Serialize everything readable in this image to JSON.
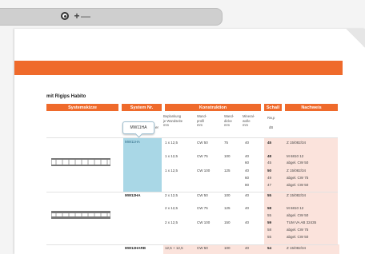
{
  "toolbar": {
    "zoom_in_label": "+",
    "zoom_out_label": "—",
    "target_icon": "target-icon"
  },
  "section": {
    "title": "mit Rigips Habito"
  },
  "table": {
    "headers": {
      "system_sketch": "Systemskizze",
      "system_no": "System Nr.",
      "construction": "Konstruktion",
      "sound": "Schall",
      "proof": "Nachweis"
    },
    "subheaders": {
      "planking": [
        "Beplankung",
        "je Wandseite",
        "mm"
      ],
      "wall_profile": [
        "Wand-",
        "profil",
        "mm"
      ],
      "wall_thickness": [
        "Wand-",
        "dicke",
        "mm"
      ],
      "mineral_wool": [
        "Mineral-",
        "wolle",
        "mm"
      ],
      "rw": "Rw,p",
      "db": "dB"
    },
    "tooltip": "MW11HA",
    "tooltip_suffix": "er",
    "groups": [
      {
        "system": "MW11HA",
        "rows": [
          {
            "planking": "1 x 12,5",
            "profile": "CW 50",
            "thickness": "75",
            "wool": "40",
            "sound": "45",
            "proof": "Z 15/082/34"
          },
          {
            "planking": "1 x 12,5",
            "profile": "CW 75",
            "thickness": "100",
            "wool": "40",
            "sound": "48",
            "proof": "M 6810 12"
          },
          {
            "planking": "",
            "profile": "",
            "thickness": "",
            "wool": "60",
            "sound": "45",
            "proof": "abgel. CW 50"
          },
          {
            "planking": "1 x 12,5",
            "profile": "CW 100",
            "thickness": "125",
            "wool": "40",
            "sound": "50",
            "proof": "Z 15/082/34"
          },
          {
            "planking": "",
            "profile": "",
            "thickness": "",
            "wool": "60",
            "sound": "49",
            "proof": "abgel. CW 75"
          },
          {
            "planking": "",
            "profile": "",
            "thickness": "",
            "wool": "80",
            "sound": "47",
            "proof": "abgel. CW 50"
          }
        ]
      },
      {
        "system": "MW12HA",
        "rows": [
          {
            "planking": "2 x 12,5",
            "profile": "CW 50",
            "thickness": "100",
            "wool": "40",
            "sound": "55",
            "proof": "Z 15/082/34"
          },
          {
            "planking": "2 x 12,5",
            "profile": "CW 75",
            "thickness": "125",
            "wool": "40",
            "sound": "58",
            "proof": "M 6810 12"
          },
          {
            "planking": "",
            "profile": "",
            "thickness": "",
            "wool": "",
            "sound": "55",
            "proof": "abgel. CW 50"
          },
          {
            "planking": "2 x 12,5",
            "profile": "CW 100",
            "thickness": "150",
            "wool": "40",
            "sound": "59",
            "proof": "TUM VA AB 32435"
          },
          {
            "planking": "",
            "profile": "",
            "thickness": "",
            "wool": "",
            "sound": "58",
            "proof": "abgel. CW 75"
          },
          {
            "planking": "",
            "profile": "",
            "thickness": "",
            "wool": "",
            "sound": "55",
            "proof": "abgel. CW 50"
          }
        ]
      },
      {
        "system": "MW12HARB",
        "rows": [
          {
            "planking": "12,5 + 12,5",
            "profile": "CW 50",
            "thickness": "100",
            "wool": "40",
            "sound": "54",
            "proof": "Z 15/082/34"
          }
        ]
      }
    ]
  }
}
